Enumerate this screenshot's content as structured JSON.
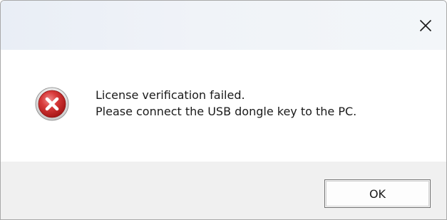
{
  "dialog": {
    "title": "",
    "close_icon": "close-icon",
    "message_icon": "error-icon",
    "message_lines": [
      "License verification failed.",
      "Please connect the USB dongle key to the PC."
    ],
    "ok_label": "OK"
  },
  "colors": {
    "error_red": "#d72b2b",
    "footer_bg": "#f0f0f0"
  }
}
